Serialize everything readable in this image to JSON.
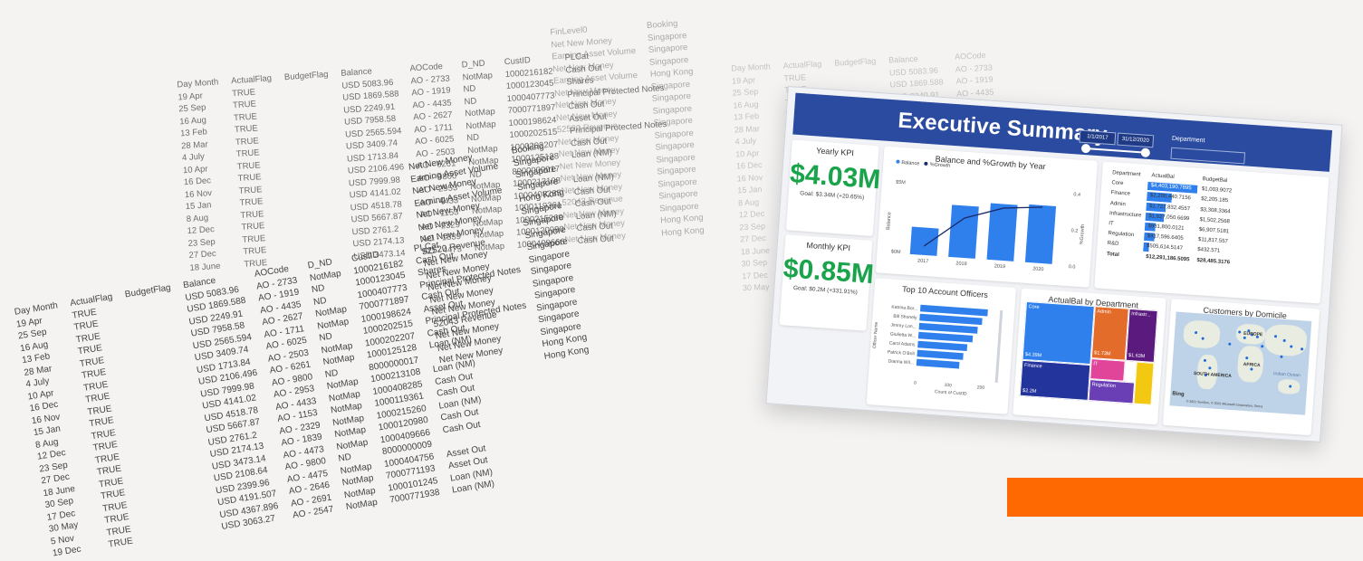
{
  "spreadsheet": {
    "headers": [
      "Day Month",
      "ActualFlag",
      "BudgetFlag",
      "Balance",
      "AOCode",
      "D_ND",
      "CustID",
      "PLCat"
    ],
    "rows": [
      [
        "19 Apr",
        "TRUE",
        "",
        "USD 5083.96",
        "AO - 2733",
        "NotMap",
        "1000216182",
        "Cash Out"
      ],
      [
        "25 Sep",
        "TRUE",
        "",
        "USD 1869.588",
        "AO - 1919",
        "ND",
        "1000123045",
        "Shares"
      ],
      [
        "16 Aug",
        "TRUE",
        "",
        "USD 2249.91",
        "AO - 4435",
        "ND",
        "1000407773",
        "Principal Protected Notes"
      ],
      [
        "13 Feb",
        "TRUE",
        "",
        "USD 7958.58",
        "AO - 2627",
        "NotMap",
        "7000771897",
        "Cash Out"
      ],
      [
        "28 Mar",
        "TRUE",
        "",
        "USD 2565.594",
        "AO - 1711",
        "NotMap",
        "1000198624",
        "Asset Out"
      ],
      [
        "4 July",
        "TRUE",
        "",
        "USD 3409.74",
        "AO - 6025",
        "ND",
        "1000202515",
        "Principal Protected Notes"
      ],
      [
        "10 Apr",
        "TRUE",
        "",
        "USD 1713.84",
        "AO - 2503",
        "NotMap",
        "1000202207",
        "Cash Out"
      ],
      [
        "16 Dec",
        "TRUE",
        "",
        "USD 2106.496",
        "AO - 6261",
        "NotMap",
        "1000125128",
        "Loan (NM)"
      ],
      [
        "16 Nov",
        "TRUE",
        "",
        "USD 7999.98",
        "AO - 9800",
        "ND",
        "8000000017",
        ""
      ],
      [
        "15 Jan",
        "TRUE",
        "",
        "USD 4141.02",
        "AO - 2953",
        "NotMap",
        "1000213108",
        "Loan (NM)"
      ],
      [
        "8 Aug",
        "TRUE",
        "",
        "USD 4518.78",
        "AO - 4433",
        "NotMap",
        "1000408285",
        "Cash Out"
      ],
      [
        "12 Dec",
        "TRUE",
        "",
        "USD 5667.87",
        "AO - 1153",
        "NotMap",
        "1000119361",
        "Cash Out"
      ],
      [
        "23 Sep",
        "TRUE",
        "",
        "USD 2761.2",
        "AO - 2329",
        "NotMap",
        "1000215260",
        "Loan (NM)"
      ],
      [
        "27 Dec",
        "TRUE",
        "",
        "USD 2174.13",
        "AO - 1839",
        "NotMap",
        "1000120980",
        "Cash Out"
      ],
      [
        "18 June",
        "TRUE",
        "",
        "USD 3473.14",
        "AO - 4473",
        "NotMap",
        "1000409666",
        "Cash Out"
      ],
      [
        "30 Sep",
        "TRUE",
        "",
        "USD 2108.64",
        "AO - 9800",
        "ND",
        "8000000009",
        ""
      ],
      [
        "17 Dec",
        "TRUE",
        "",
        "USD 2399.96",
        "AO - 4475",
        "NotMap",
        "1000404756",
        "Asset Out"
      ],
      [
        "30 May",
        "TRUE",
        "",
        "USD 4191.507",
        "AO - 2646",
        "NotMap",
        "7000771193",
        "Asset Out"
      ],
      [
        "5 Nov",
        "TRUE",
        "",
        "USD 4367.896",
        "AO - 2691",
        "NotMap",
        "1000101245",
        "Loan (NM)"
      ],
      [
        "19 Dec",
        "TRUE",
        "",
        "USD 3063.27",
        "AO - 2547",
        "NotMap",
        "7000771938",
        "Loan (NM)"
      ]
    ],
    "fin_header": "FinLevel0",
    "booking_header": "Booking",
    "fin_values": [
      "Net New Money",
      "Earning Asset Volume",
      "Net New Money",
      "Earning Asset Volume",
      "Net New Money",
      "Net New Money",
      "Net New Money",
      "52520 Revenue",
      "Net New Money",
      "Net New Money",
      "Net New Money",
      "Net New Money",
      "Net New Money",
      "52043 Revenue",
      "Net New Money",
      "Net New Money",
      "Net New Money"
    ],
    "booking_values": [
      "Singapore",
      "Singapore",
      "Singapore",
      "Hong Kong",
      "Singapore",
      "Singapore",
      "Singapore",
      "Singapore",
      "Singapore",
      "Singapore",
      "Singapore",
      "Singapore",
      "Singapore",
      "Singapore",
      "Singapore",
      "Hong Kong",
      "Hong Kong"
    ]
  },
  "dashboard": {
    "title": "Executive Summary",
    "date_start": "1/1/2017",
    "date_end": "31/12/2020",
    "department_label": "Department",
    "yearly_kpi": {
      "title": "Yearly KPI",
      "value": "$4.03M",
      "goal": "Goal: $3.34M (+20.65%)"
    },
    "monthly_kpi": {
      "title": "Monthly KPI",
      "value": "$0.85M",
      "goal": "Goal: $0.2M (+331.91%)"
    },
    "balance_chart": {
      "title": "Balance and %Growth by Year",
      "legend": [
        "Balance",
        "%Growth"
      ],
      "ylabel": "Balance",
      "y2label": "%Growth",
      "ytick_top": "$5M",
      "ytick_bottom": "$0M",
      "y2ticks": [
        "0.4",
        "0.2",
        "0.0"
      ]
    },
    "dept_table": {
      "headers": [
        "Department",
        "ActualBal",
        "BudgetBal"
      ],
      "rows": [
        {
          "name": "Core",
          "actual": "$4,403,190.7895",
          "budget": "$1,003.9072",
          "bar": 1.0
        },
        {
          "name": "Finance",
          "actual": "$2,200,440.7156",
          "budget": "$2,205.185",
          "bar": 0.5
        },
        {
          "name": "Admin",
          "actual": "$1,727,832.4557",
          "budget": "$3,308.3364",
          "bar": 0.39
        },
        {
          "name": "Infrastructure",
          "actual": "$1,627,050.6699",
          "budget": "$1,502.2568",
          "bar": 0.37
        },
        {
          "name": "IT",
          "actual": "$931,800.0121",
          "budget": "$6,907.5181",
          "bar": 0.21
        },
        {
          "name": "Regulation",
          "actual": "$917,596.6405",
          "budget": "$11,817.557",
          "bar": 0.21
        },
        {
          "name": "R&D",
          "actual": "$505,614.5147",
          "budget": "$432.571",
          "bar": 0.11
        }
      ],
      "total_label": "Total",
      "total_actual": "$12,291,186.5095",
      "total_budget": "$28,485.3176"
    },
    "officers_chart": {
      "title": "Top 10 Account Officers",
      "names": [
        "Katrina Bor...",
        "Bill Shonely",
        "Jimmy Lon...",
        "Giulietta W...",
        "Carol Adams",
        "Patrick O'Brill",
        "Dianna Wil..."
      ],
      "ylabel": "Officer Name",
      "xlabel": "Count of CustID",
      "xticks": [
        "0",
        "100",
        "200"
      ]
    },
    "treemap": {
      "title": "ActualBal by Department",
      "tiles": [
        {
          "label": "Core",
          "value": "$4.39M",
          "color": "#2f80ed"
        },
        {
          "label": "Finance",
          "value": "$2.2M",
          "color": "#23349c"
        },
        {
          "label": "Admin",
          "value": "$1.73M",
          "color": "#e46c2b"
        },
        {
          "label": "Infrastr...",
          "value": "$1.63M",
          "color": "#5b1a7e"
        },
        {
          "label": "IT",
          "value": "",
          "color": "#e0459a"
        },
        {
          "label": "Regulation",
          "value": "",
          "color": "#6a3fb5"
        },
        {
          "label": "",
          "value": "",
          "color": "#f2c811"
        }
      ]
    },
    "map": {
      "title": "Customers by Domicile",
      "labels": [
        "EUROPE",
        "AFRICA",
        "SOUTH AMERICA",
        "Indian Ocean"
      ],
      "footer": "© 2021 TomTom, © 2021 Microsoft Corporation, Terms",
      "logo": "Bing"
    }
  },
  "balance_values": [
    1.9,
    3.6,
    3.9,
    4.0
  ],
  "growth_values": [
    0.05,
    0.22,
    0.29,
    0.31
  ],
  "balance_years": [
    "2017",
    "2018",
    "2019",
    "2020"
  ],
  "officer_values": [
    205,
    190,
    178,
    165,
    150,
    140,
    130
  ]
}
